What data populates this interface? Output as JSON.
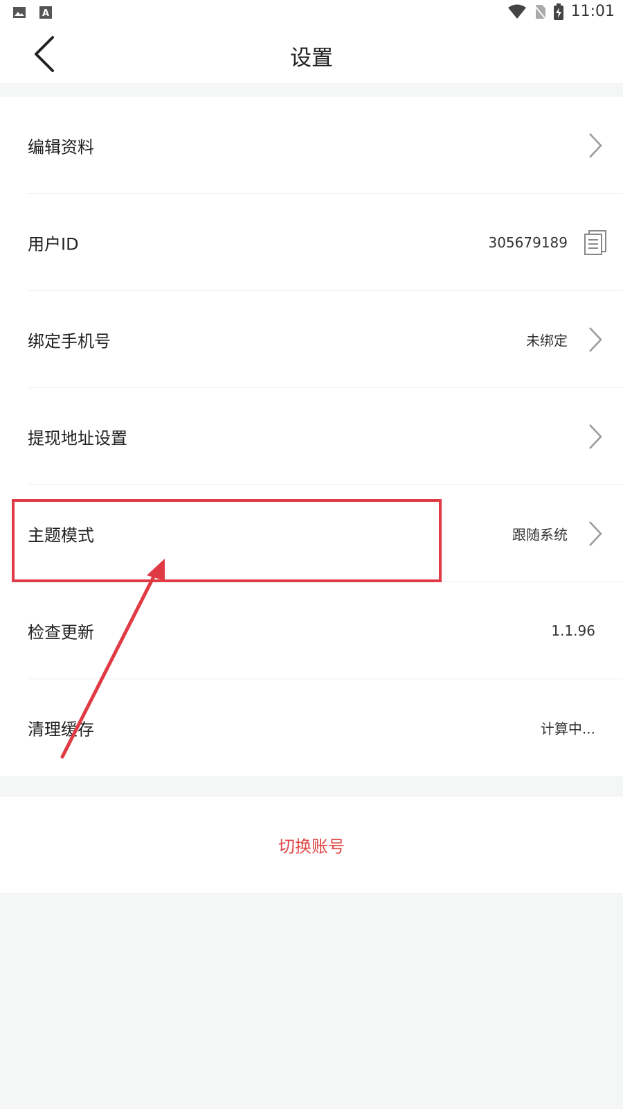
{
  "status": {
    "time": "11:01"
  },
  "header": {
    "title": "设置"
  },
  "rows": [
    {
      "label": "编辑资料",
      "value": ""
    },
    {
      "label": "用户ID",
      "value": "305679189"
    },
    {
      "label": "绑定手机号",
      "value": "未绑定"
    },
    {
      "label": "提现地址设置",
      "value": ""
    },
    {
      "label": "主题模式",
      "value": "跟随系统"
    },
    {
      "label": "检查更新",
      "value": "1.1.96"
    },
    {
      "label": "清理缓存",
      "value": "计算中..."
    }
  ],
  "actions": {
    "switch_account": "切换账号"
  },
  "colors": {
    "accent_red": "#e04545",
    "annotation_red": "#e03a45",
    "background": "#f5f7f6"
  }
}
